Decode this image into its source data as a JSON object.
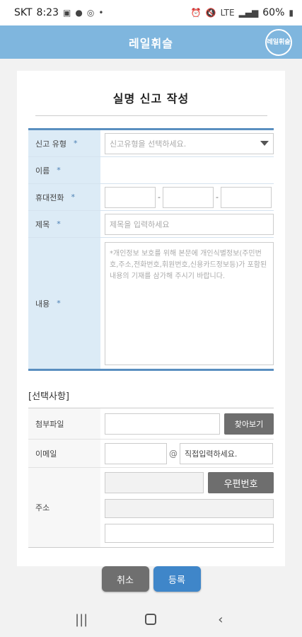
{
  "status_bar": {
    "carrier": "SKT",
    "time": "8:23",
    "battery": "60%",
    "left_icons": [
      "image-icon",
      "chat-icon",
      "sync-icon",
      "dot-icon"
    ],
    "right_icons": [
      "alarm-icon",
      "mute-icon",
      "lte-icon",
      "signal-icon",
      "battery-icon"
    ]
  },
  "header": {
    "title": "레일휘슬",
    "logo_text": "레일휘슬"
  },
  "page": {
    "title": "실명 신고 작성"
  },
  "form": {
    "report_type": {
      "label": "신고 유형",
      "required": "*",
      "placeholder": "신고유형을 선택하세요."
    },
    "name": {
      "label": "이름",
      "required": "*",
      "value": ""
    },
    "phone": {
      "label": "휴대전화",
      "required": "*",
      "sep": "-"
    },
    "subject": {
      "label": "제목",
      "required": "*",
      "placeholder": "제목을 입력하세요"
    },
    "content": {
      "label": "내용",
      "required": "*",
      "placeholder": "*개인정보 보호를 위해 본문에 개인식별정보(주민번호,주소,전화번호,휘원번호,신용카드정보등)가 포함된 내용의 기재를 삼가해 주시기 바랍니다."
    }
  },
  "optional": {
    "title": "[선택사항]",
    "attachment": {
      "label": "첨부파일",
      "button": "찾아보기"
    },
    "email": {
      "label": "이메일",
      "at": "@",
      "domain_placeholder": "직접입력하세요."
    },
    "address": {
      "label": "주소",
      "zip_button": "우편번호"
    }
  },
  "actions": {
    "cancel": "취소",
    "submit": "등록"
  },
  "colors": {
    "header": "#7fb6de",
    "label_bg": "#dcebf6",
    "border": "#5a8fc0",
    "submit": "#3f86c9",
    "cancel": "#6f6f6f"
  }
}
